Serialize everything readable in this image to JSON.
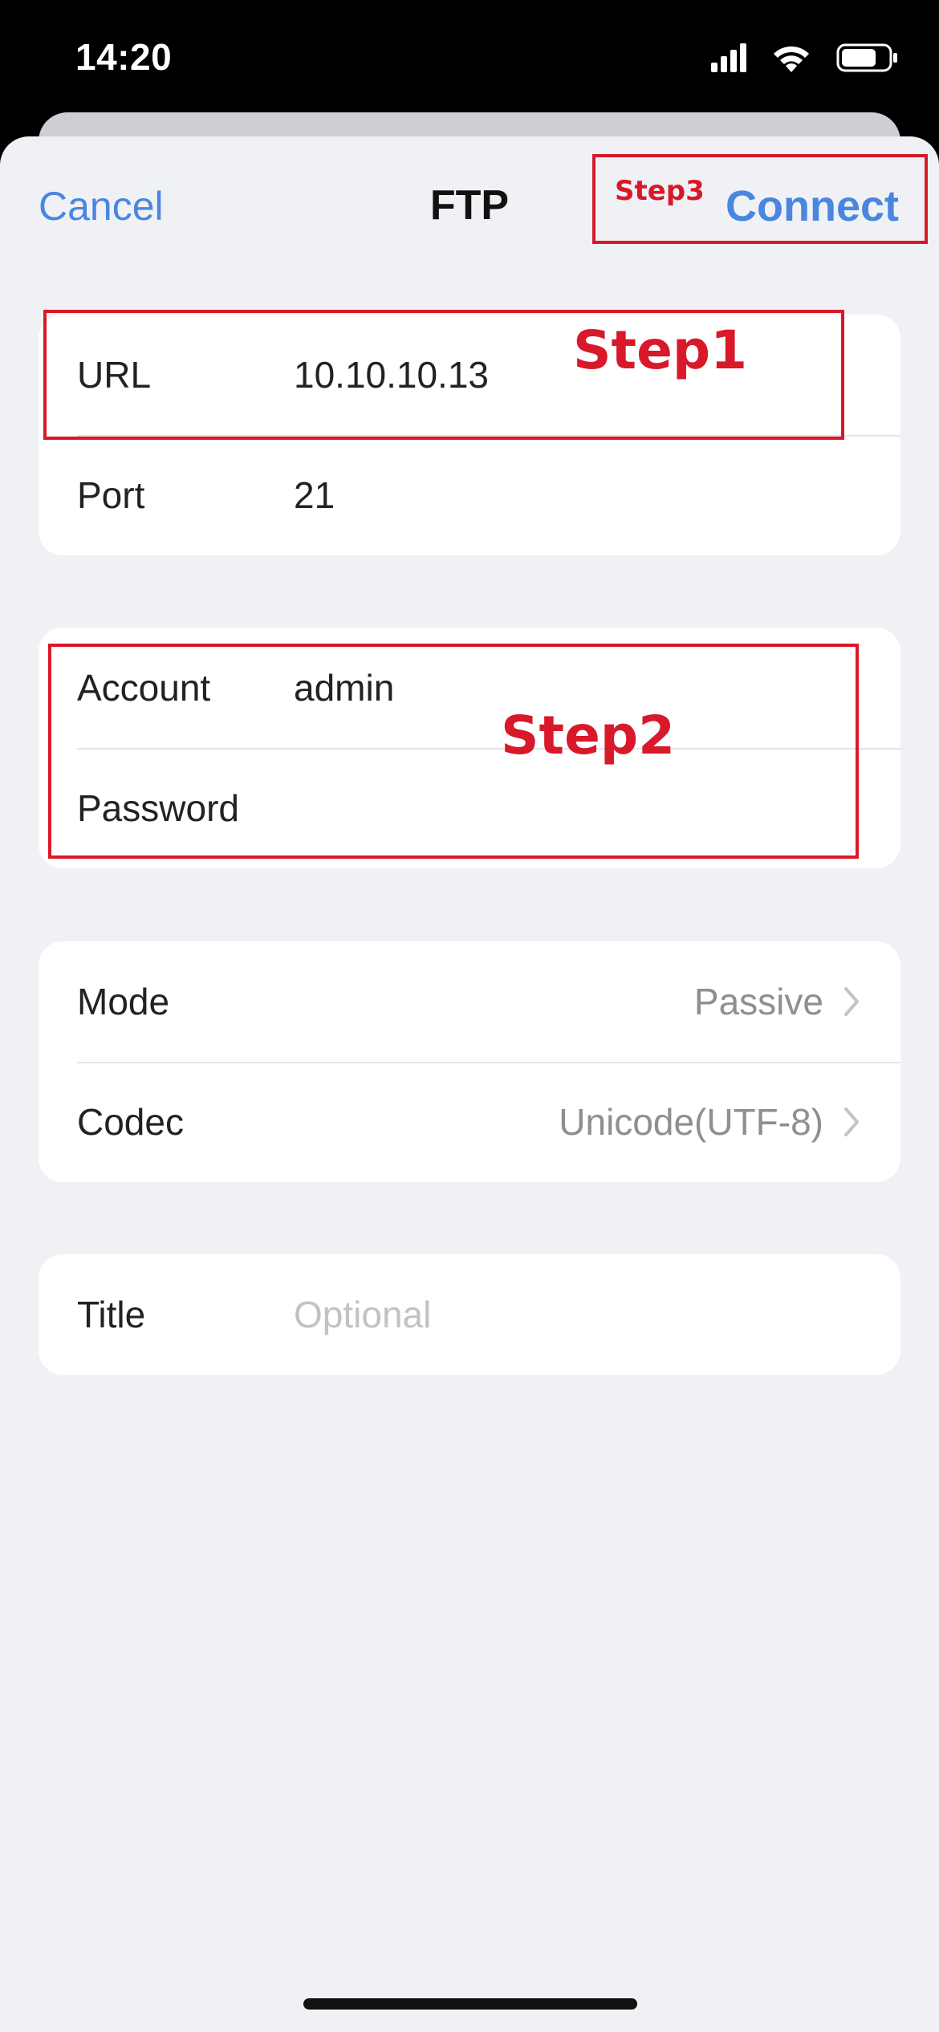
{
  "status_bar": {
    "time": "14:20",
    "icons": [
      "cellular-signal-icon",
      "wifi-icon",
      "battery-icon"
    ]
  },
  "nav": {
    "cancel_label": "Cancel",
    "title": "FTP",
    "connect_label": "Connect"
  },
  "server": {
    "url_label": "URL",
    "url_value": "10.10.10.13",
    "port_label": "Port",
    "port_value": "21"
  },
  "credentials": {
    "account_label": "Account",
    "account_value": "admin",
    "password_label": "Password",
    "password_value": ""
  },
  "options": {
    "mode_label": "Mode",
    "mode_value": "Passive",
    "codec_label": "Codec",
    "codec_value": "Unicode(UTF-8)"
  },
  "title_field": {
    "label": "Title",
    "placeholder": "Optional"
  },
  "annotations": {
    "step1": "Step1",
    "step2": "Step2",
    "step3": "Step3"
  },
  "colors": {
    "accent": "#4a86e0",
    "annotation": "#d7192a",
    "sheet_background": "#f0f1f5"
  }
}
